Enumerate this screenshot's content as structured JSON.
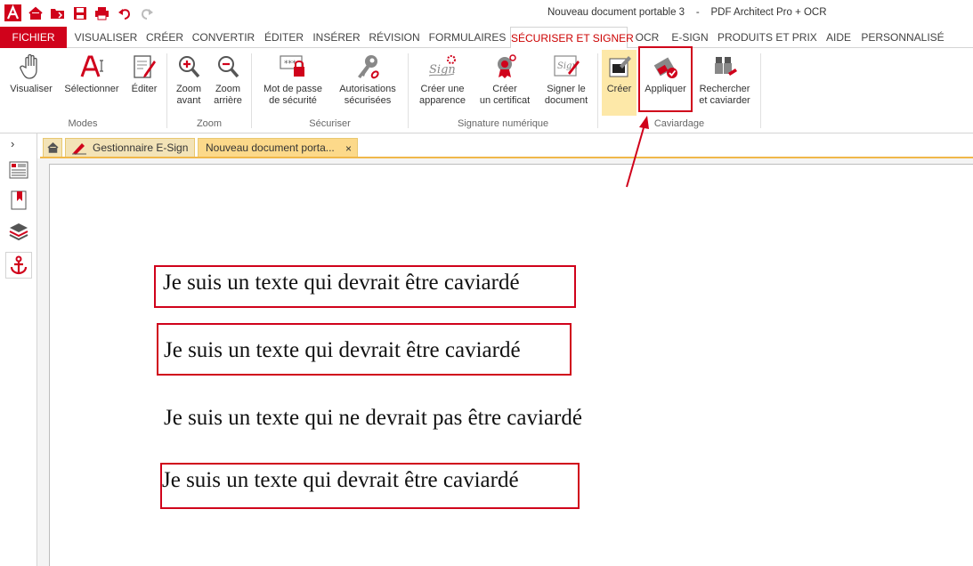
{
  "window": {
    "document_title": "Nouveau document portable 3",
    "separator": "-",
    "app_name": "PDF Architect Pro + OCR"
  },
  "menu": {
    "tabs": [
      {
        "label": "FICHIER"
      },
      {
        "label": "VISUALISER"
      },
      {
        "label": "CRÉER"
      },
      {
        "label": "CONVERTIR"
      },
      {
        "label": "ÉDITER"
      },
      {
        "label": "INSÉRER"
      },
      {
        "label": "RÉVISION"
      },
      {
        "label": "FORMULAIRES"
      },
      {
        "label": "SÉCURISER ET SIGNER"
      },
      {
        "label": "OCR"
      },
      {
        "label": "E-SIGN"
      },
      {
        "label": "PRODUITS ET PRIX"
      },
      {
        "label": "AIDE"
      },
      {
        "label": "PERSONNALISÉ"
      }
    ],
    "active": "SÉCURISER ET SIGNER"
  },
  "ribbon": {
    "modes": {
      "label": "Modes",
      "visualiser": "Visualiser",
      "selectionner": "Sélectionner",
      "editer": "Éditer"
    },
    "zoom": {
      "label": "Zoom",
      "zoom_avant_1": "Zoom",
      "zoom_avant_2": "avant",
      "zoom_arriere_1": "Zoom",
      "zoom_arriere_2": "arrière"
    },
    "securiser": {
      "label": "Sécuriser",
      "mdp_1": "Mot de passe",
      "mdp_2": "de sécurité",
      "auth_1": "Autorisations",
      "auth_2": "sécurisées"
    },
    "signature": {
      "label": "Signature numérique",
      "apparence_1": "Créer une",
      "apparence_2": "apparence",
      "certificat_1": "Créer",
      "certificat_2": "un certificat",
      "signer_1": "Signer le",
      "signer_2": "document"
    },
    "caviardage": {
      "label": "Caviardage",
      "creer": "Créer",
      "appliquer": "Appliquer",
      "rechercher_1": "Rechercher",
      "rechercher_2": "et caviarder"
    },
    "icon_labels": {
      "sign": "Sign",
      "password_mask": "***"
    }
  },
  "doc_tabs": {
    "esign": "Gestionnaire E-Sign",
    "document": "Nouveau document porta...",
    "close": "×"
  },
  "left_panel": {
    "toggle": "›"
  },
  "document": {
    "line1": "Je suis un texte qui devrait être caviardé",
    "line2": "Je suis un texte qui devrait être caviardé",
    "line3": "Je suis un texte qui ne devrait pas être caviardé",
    "line4": "Je suis un texte qui devrait être caviardé"
  },
  "colors": {
    "accent_red": "#d0021b",
    "tab_yellow": "#fcd98a",
    "highlight": "#fde8a8"
  }
}
